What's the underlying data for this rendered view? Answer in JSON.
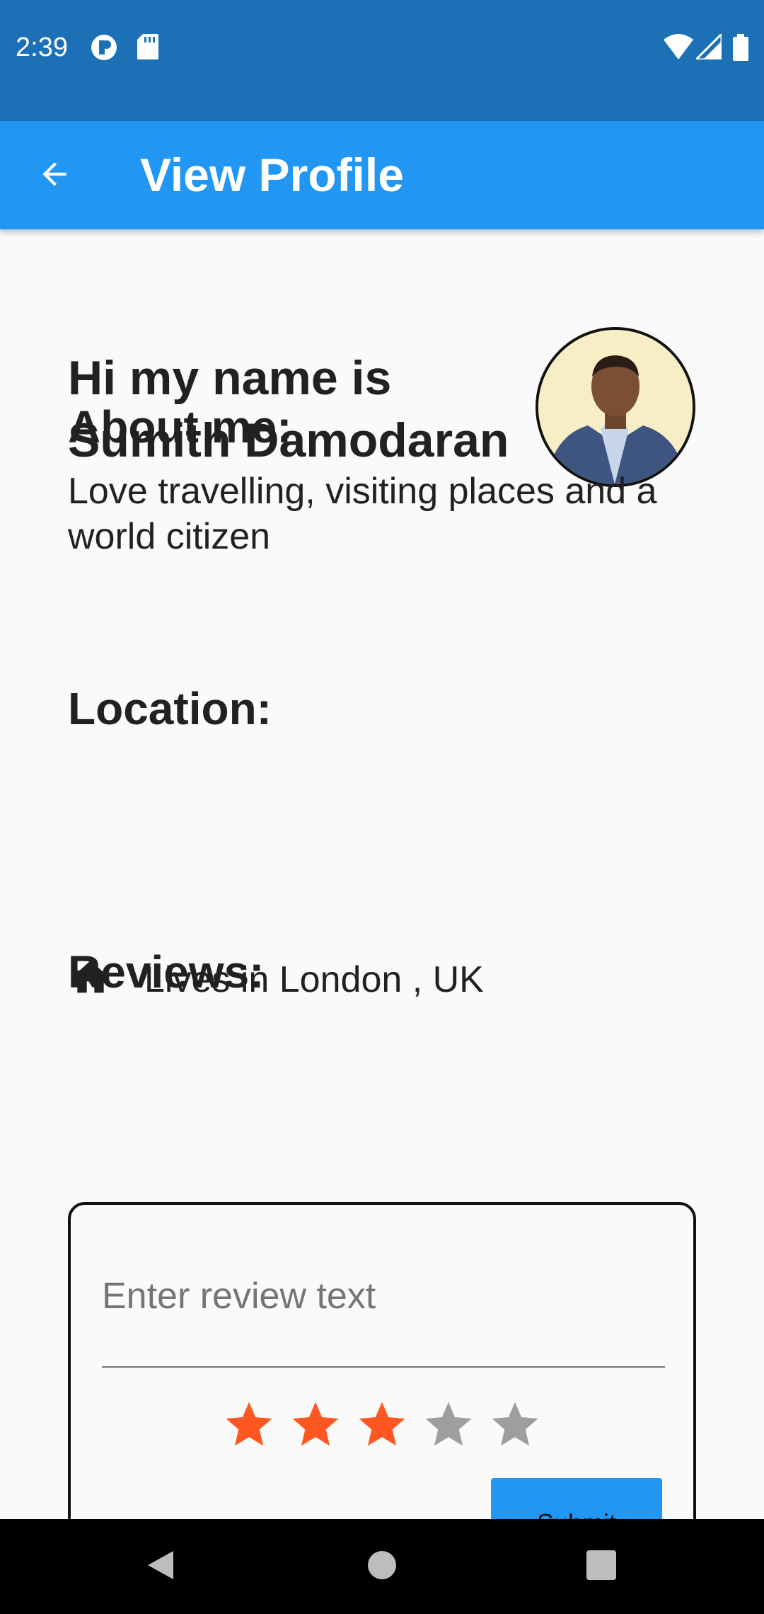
{
  "status_bar": {
    "time": "2:39",
    "icons": [
      "notification-app-icon",
      "sd-card-icon",
      "wifi-icon",
      "signal-icon",
      "battery-icon"
    ]
  },
  "app_bar": {
    "title": "View Profile",
    "back_icon": "arrow-back-icon"
  },
  "profile": {
    "greeting_line1": "Hi my name is",
    "greeting_line2": "Sumith Damodaran",
    "about_heading": "About me:",
    "about_text": "Love travelling, visiting places and a world citizen",
    "location_heading": "Location:",
    "location_icon": "home-icon",
    "location_text": "Lives in London , UK",
    "reviews_heading": "Reviews:"
  },
  "review_form": {
    "placeholder": "Enter review text",
    "rating": 3,
    "max_rating": 5,
    "submit_label": "Submit"
  },
  "colors": {
    "status_bar": "#1b70b6",
    "app_bar": "#2196f3",
    "star_active": "#ff5722",
    "star_inactive": "#9e9e9e"
  }
}
